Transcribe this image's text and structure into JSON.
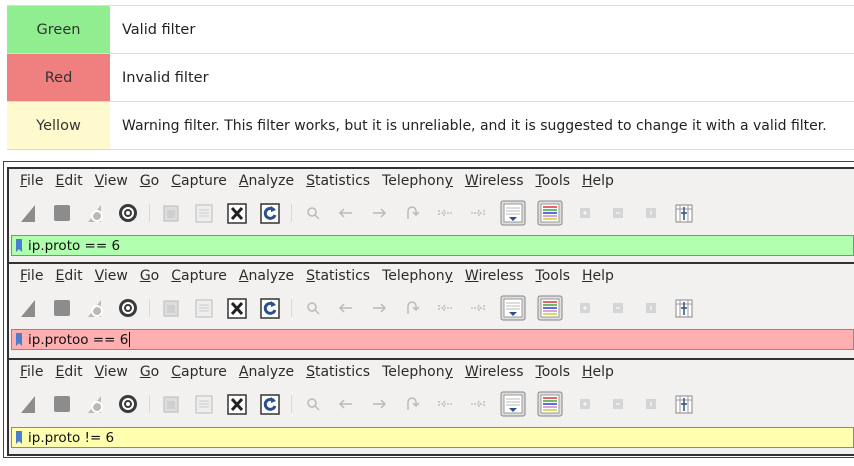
{
  "legend": [
    {
      "label": "Green",
      "description": "Valid filter",
      "color": "#90ee90"
    },
    {
      "label": "Red",
      "description": "Invalid filter",
      "color": "#f08080"
    },
    {
      "label": "Yellow",
      "description": "Warning filter. This filter works, but it is unreliable, and it is suggested to change it with a valid filter.",
      "color": "#fffacd"
    }
  ],
  "menu": {
    "file": "File",
    "edit": "Edit",
    "view": "View",
    "go": "Go",
    "capture": "Capture",
    "analyze": "Analyze",
    "statistics": "Statistics",
    "telephony": "Telephony",
    "wireless": "Wireless",
    "tools": "Tools",
    "help": "Help"
  },
  "windows": [
    {
      "filter": "ip.proto == 6",
      "filter_color": "#afffaf"
    },
    {
      "filter": "ip.protoo == 6",
      "filter_color": "#ffafaf"
    },
    {
      "filter": "ip.proto != 6",
      "filter_color": "#ffffaf"
    }
  ],
  "toolbar_icons": [
    "start-capture-icon",
    "stop-capture-icon",
    "restart-capture-icon",
    "capture-options-icon",
    "open-file-icon",
    "save-file-icon",
    "close-file-icon",
    "reload-file-icon",
    "find-icon",
    "go-back-icon",
    "go-forward-icon",
    "go-to-packet-icon",
    "first-packet-icon",
    "last-packet-icon",
    "auto-scroll-icon",
    "colorize-icon",
    "zoom-in-icon",
    "zoom-out-icon",
    "normal-size-icon",
    "resize-columns-icon"
  ]
}
